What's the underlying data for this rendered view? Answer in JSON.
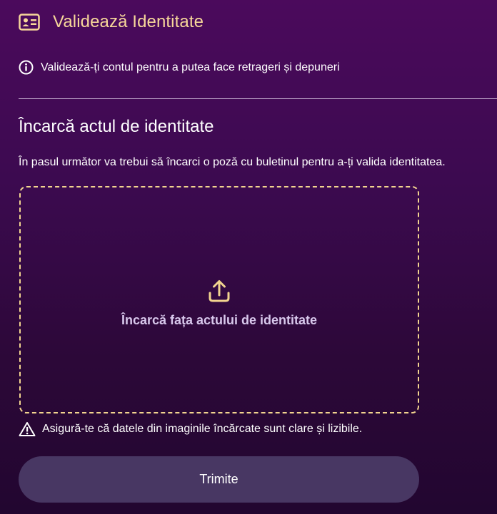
{
  "header": {
    "icon": "id-card-icon",
    "title": "Validează Identitate"
  },
  "info": {
    "icon": "info-circle-icon",
    "text": "Validează-ți contul pentru a putea face retrageri și depuneri"
  },
  "upload_section": {
    "title": "Încarcă actul de identitate",
    "description": "În pasul următor va trebui să încarci o poză cu buletinul pentru a-ți valida identitatea.",
    "dropzone": {
      "icon": "upload-icon",
      "label": "Încarcă fața actului de identitate"
    }
  },
  "warning": {
    "icon": "warning-triangle-icon",
    "text": "Asigură-te că datele din imaginile încărcate sunt clare și lizibile."
  },
  "submit": {
    "label": "Trimite"
  },
  "colors": {
    "accent": "#f7d79a",
    "button_bg": "#483763",
    "background_top": "#4b0a5c",
    "background_bottom": "#220630"
  }
}
